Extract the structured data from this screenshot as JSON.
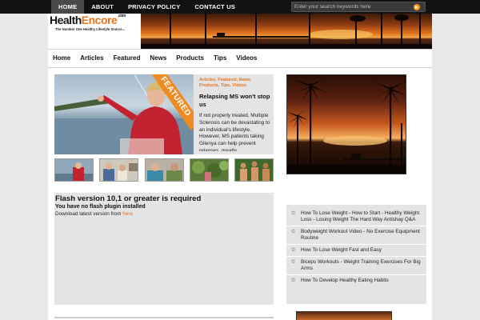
{
  "topnav": {
    "items": [
      {
        "label": "HOME",
        "active": true
      },
      {
        "label": "ABOUT",
        "active": false
      },
      {
        "label": "PRIVACY POLICY",
        "active": false
      },
      {
        "label": "CONTACT US",
        "active": false
      }
    ]
  },
  "search": {
    "placeholder": "Enter your search keywords here",
    "go_icon": "arrow-right-icon"
  },
  "logo": {
    "part1": "Health",
    "part2": "Encore",
    "suffix": ".com",
    "tagline": "The Number One Healthy Lifestyle Source..."
  },
  "mainnav": {
    "items": [
      "Home",
      "Articles",
      "Featured",
      "News",
      "Products",
      "Tips",
      "Videos"
    ]
  },
  "featured": {
    "ribbon": "FEATURED",
    "tags": "Articles, Featured, News, Products, Tips, Videos",
    "title": "Relapsing MS won't stop us",
    "excerpt": "If not properly treated, Multiple Sclerosis can be devastating to an individual's lifestyle. However, MS patients taking Gilenya can help prevent relapses, greatly"
  },
  "flash": {
    "title": "Flash version 10,1 or greater is required",
    "subtitle": "You have no flash plugin installed",
    "download_text": "Download latest version from ",
    "download_link": "here"
  },
  "sidebar": {
    "items": [
      "How To Lose Weight - How to Start - Healthy Weight Loss - Losing Weight The Hard Way Antishay Q&A",
      "Bodyweight Workout Video - No Exercise Equipment Routine",
      "How To Lose Weight Fast and Easy",
      "Biceps Workouts - Weight Training Exercises For Big Arms",
      "How To Develop Healthy Eating Habits"
    ]
  },
  "colors": {
    "accent": "#e8731a",
    "topbar": "#111111",
    "box_bg": "#e4e4e4"
  }
}
